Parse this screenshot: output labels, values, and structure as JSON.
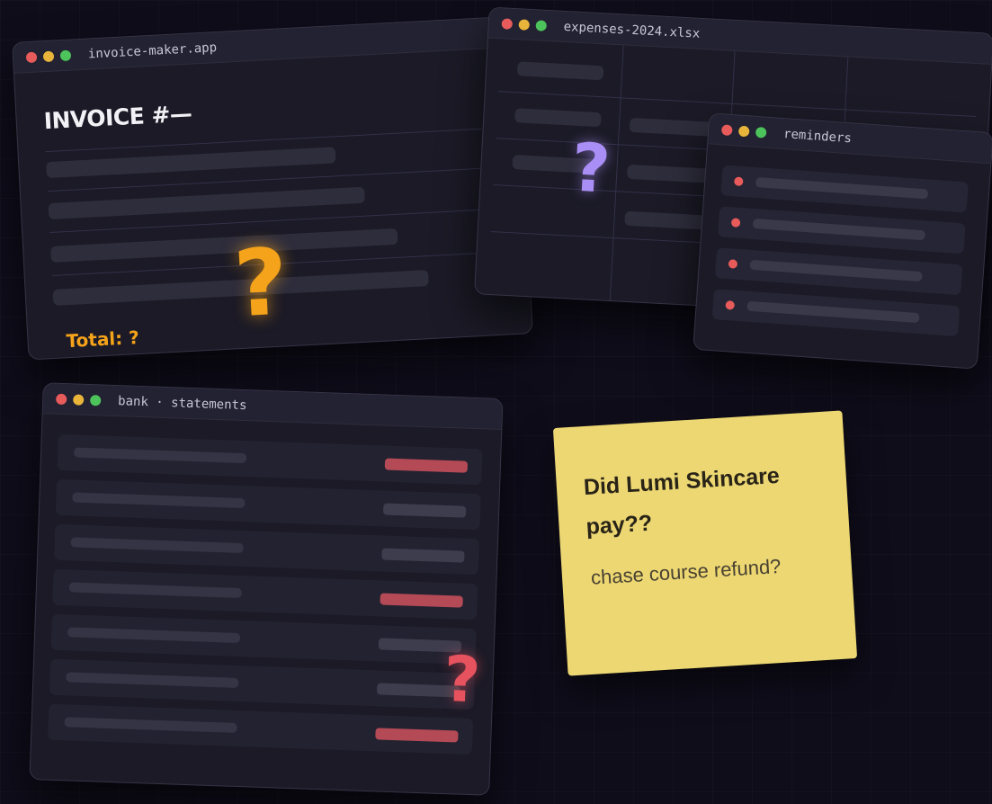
{
  "invoice_window": {
    "title": "invoice-maker.app",
    "heading": "INVOICE #—",
    "total": "Total: ?",
    "question_mark": "?"
  },
  "expenses_window": {
    "title": "expenses-2024.xlsx",
    "question_mark": "?"
  },
  "reminders_window": {
    "title": "reminders"
  },
  "bank_window": {
    "title": "bank · statements",
    "question_mark": "?"
  },
  "sticky_note": {
    "title": "Did Lumi Skincare pay??",
    "note": "chase course refund?"
  },
  "colors": {
    "background": "#0f0d1a",
    "window": "#1b1a26",
    "accent_orange": "#f5a31a",
    "accent_purple": "#a98ef5",
    "accent_red": "#e6525e",
    "sticky_yellow": "#ecd772"
  },
  "icons": [
    "close-dot-icon",
    "minimize-dot-icon",
    "maximize-dot-icon",
    "question-mark-icon",
    "bullet-dot-icon"
  ]
}
